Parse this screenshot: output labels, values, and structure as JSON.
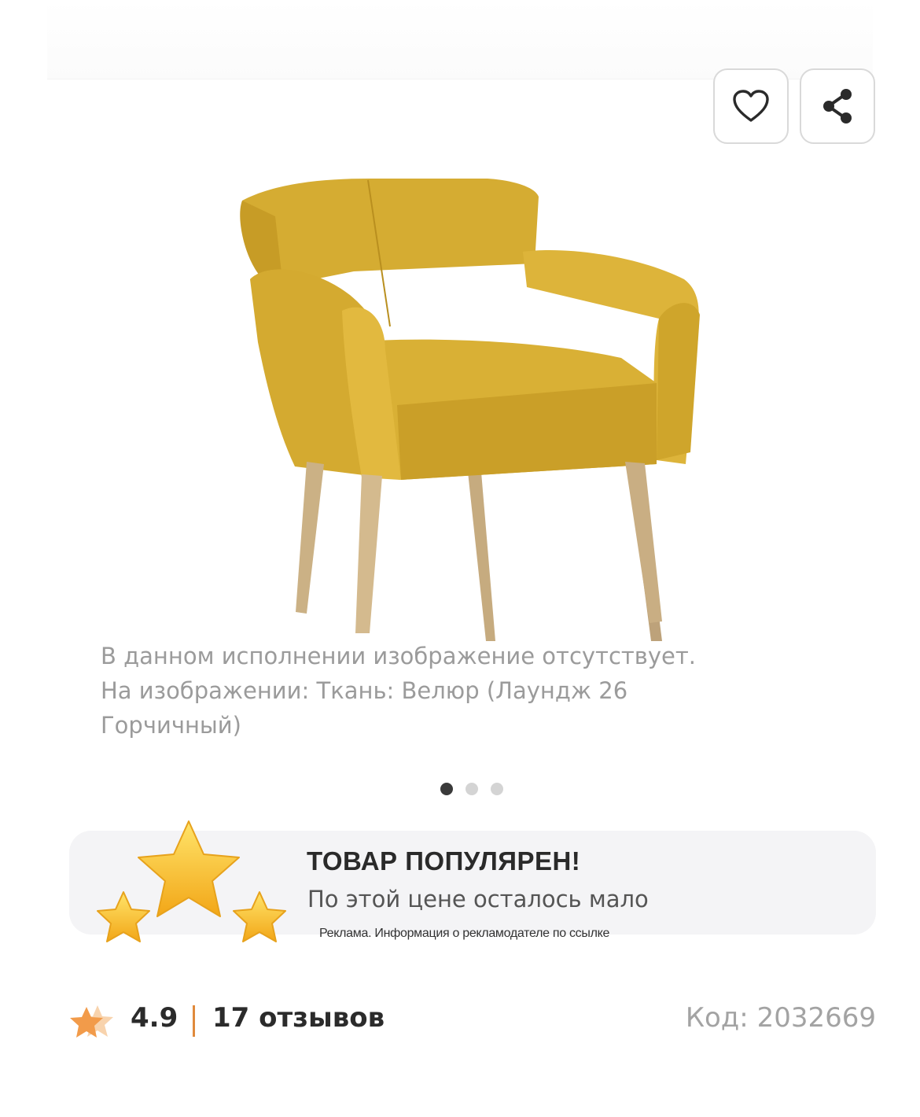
{
  "product": {
    "image_alt": "Кресло",
    "image_caption_lines": [
      "В данном исполнении изображение отсутствует.",
      "На изображении: Ткань: Велюр (Лаундж 26",
      "Горчичный)"
    ],
    "slides_total": 3,
    "slide_active_index": 0
  },
  "actions": {
    "favorite_icon": "heart-icon",
    "share_icon": "share-icon"
  },
  "promo": {
    "title": "ТОВАР ПОПУЛЯРЕН!",
    "subtitle": "По этой цене осталось мало",
    "ad_note": "Реклама. Информация о рекламодателе по ссылке"
  },
  "rating": {
    "value": "4.9",
    "reviews": "17 отзывов",
    "code": "Код: 2032669"
  },
  "colors": {
    "accent": "#e08a3c",
    "star": "#f29b4a",
    "chair": "#d9ae35"
  }
}
